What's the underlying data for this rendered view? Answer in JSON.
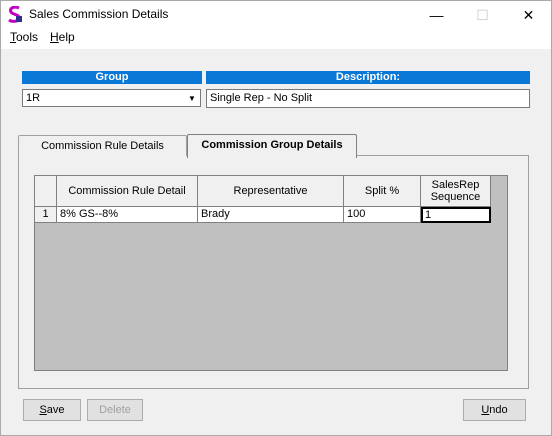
{
  "window": {
    "title": "Sales Commission Details",
    "minimize_glyph": "—",
    "maximize_glyph": "☐",
    "close_glyph": "✕"
  },
  "menu": {
    "tools_first": "T",
    "tools_rest": "ools",
    "help_first": "H",
    "help_rest": "elp"
  },
  "header": {
    "group_label": "Group",
    "description_label": "Description:",
    "group_value": "1R",
    "description_value": "Single Rep - No Split"
  },
  "tabs": [
    {
      "label": "Commission Rule Details",
      "active": false
    },
    {
      "label": "Commission Group Details",
      "active": true
    }
  ],
  "grid": {
    "columns": [
      "Commission Rule Detail",
      "Representative",
      "Split %",
      "SalesRep Sequence"
    ],
    "rows": [
      {
        "num": "1",
        "rule": "8% GS--8%",
        "rep": "Brady",
        "split": "100",
        "sequence": "1"
      }
    ]
  },
  "buttons": {
    "save_first": "S",
    "save_rest": "ave",
    "delete_label": "Delete",
    "undo_first": "U",
    "undo_rest": "ndo"
  },
  "colors": {
    "header_blue": "#0a78d7",
    "grid_background": "#c0c0c0",
    "app_icon_purple": "#c000c0"
  },
  "icons": {
    "app": "sales-app-icon",
    "dropdown": "chevron-down-icon"
  }
}
